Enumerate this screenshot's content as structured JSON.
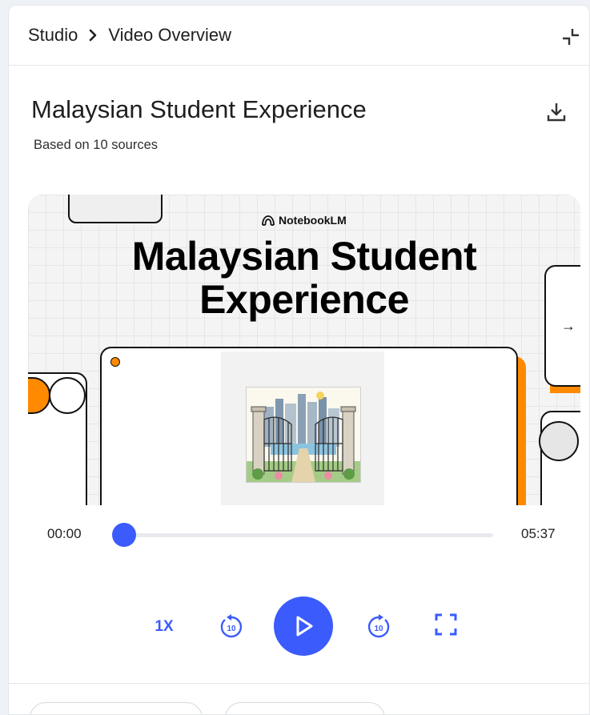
{
  "breadcrumb": {
    "root": "Studio",
    "current": "Video Overview"
  },
  "overview": {
    "title": "Malaysian Student Experience",
    "subtitle": "Based on 10 sources"
  },
  "video": {
    "brand": "NotebookLM",
    "title_line1": "Malaysian Student",
    "title_line2": "Experience",
    "next_arrow": "→"
  },
  "player": {
    "current_time": "00:00",
    "duration": "05:37",
    "progress_fraction": 0.0,
    "speed": "1X"
  },
  "colors": {
    "accent": "#3b5bfd",
    "orange": "#ff8a00",
    "text": "#1f1f1f"
  },
  "icons": {
    "collapse": "collapse-icon",
    "download": "download-icon",
    "replay": "replay-10-icon",
    "forward": "forward-10-icon",
    "play": "play-icon",
    "fullscreen": "fullscreen-icon"
  }
}
